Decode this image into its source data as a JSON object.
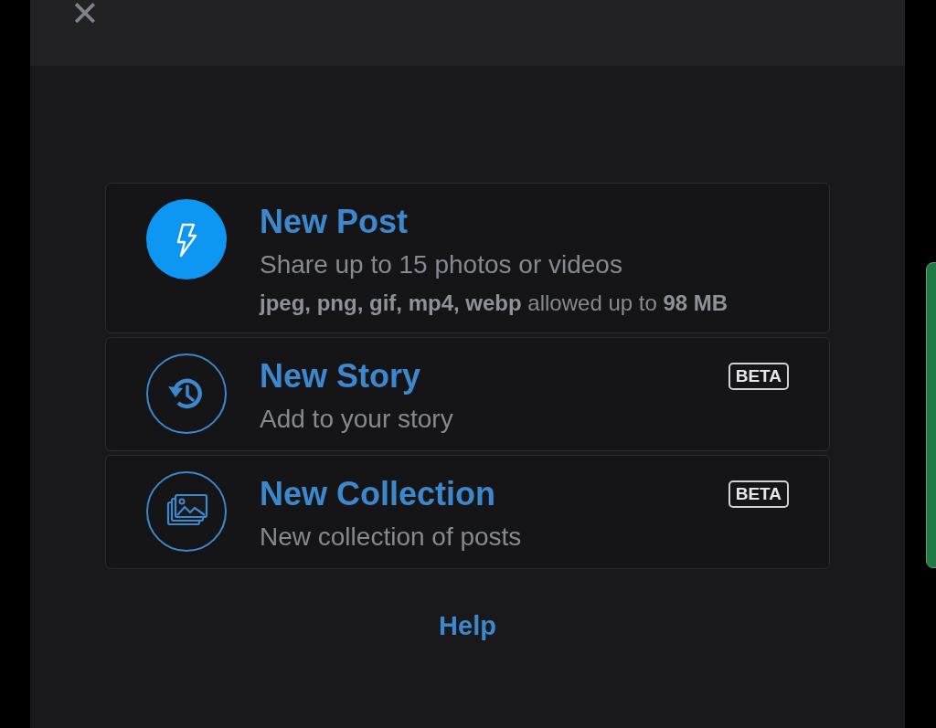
{
  "close_button": {
    "label": "✕"
  },
  "options": [
    {
      "kind": "post",
      "title": "New Post",
      "subtitle": "Share up to 15 photos or videos",
      "details": "**jpeg, png, gif, mp4, webp** allowed up to **98 MB**"
    },
    {
      "kind": "story",
      "title": "New Story",
      "subtitle": "Add to your story",
      "badge": "BETA"
    },
    {
      "kind": "collection",
      "title": "New Collection",
      "subtitle": "New collection of posts",
      "badge": "BETA"
    }
  ],
  "help_link": "Help"
}
